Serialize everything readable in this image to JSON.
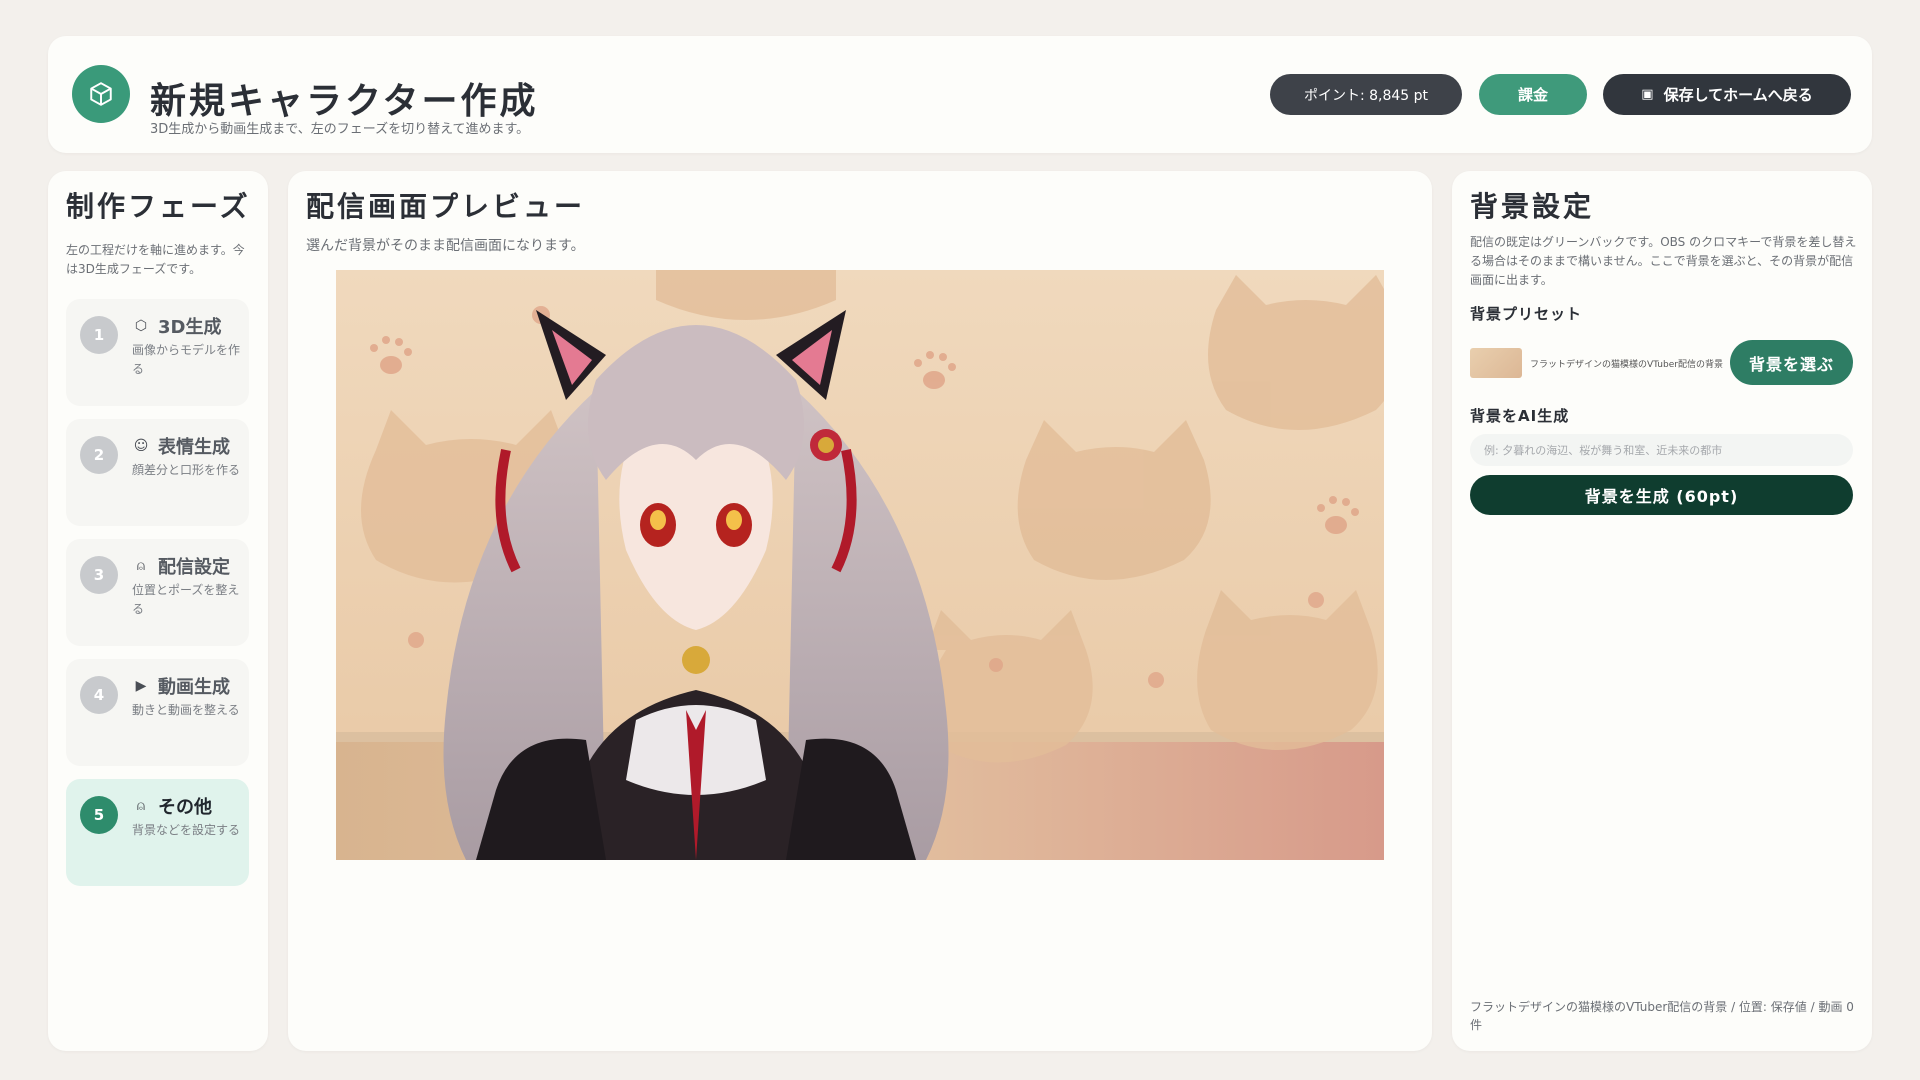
{
  "header": {
    "title": "新規キャラクター作成",
    "subtitle": "3D生成から動画生成まで、左のフェーズを切り替えて進めます。",
    "logo_icon": "cube-icon",
    "points_label": "ポイント: 8,845 pt",
    "charge_label": "課金",
    "save_home_label": "保存してホームへ戻る",
    "save_icon": "save-icon"
  },
  "phases": {
    "title": "制作フェーズ",
    "description": "左の工程だけを軸に進めます。今は3D生成フェーズです。",
    "items": [
      {
        "num": "1",
        "icon": "cube-icon",
        "glyph": "⬡",
        "title": "3D生成",
        "desc": "画像からモデルを作る",
        "active": false
      },
      {
        "num": "2",
        "icon": "smile-icon",
        "glyph": "☺",
        "title": "表情生成",
        "desc": "顔差分と口形を作る",
        "active": false
      },
      {
        "num": "3",
        "icon": "user-icon",
        "glyph": "⍝",
        "title": "配信設定",
        "desc": "位置とポーズを整える",
        "active": false
      },
      {
        "num": "4",
        "icon": "play-icon",
        "glyph": "▶",
        "title": "動画生成",
        "desc": "動きと動画を整える",
        "active": false
      },
      {
        "num": "5",
        "icon": "user-icon",
        "glyph": "⍝",
        "title": "その他",
        "desc": "背景などを設定する",
        "active": true
      }
    ]
  },
  "preview": {
    "title": "配信画面プレビュー",
    "description": "選んだ背景がそのまま配信画面になります。"
  },
  "background": {
    "title": "背景設定",
    "description": "配信の既定はグリーンバックです。OBS のクロマキーで背景を差し替える場合はそのままで構いません。ここで背景を選ぶと、その背景が配信画面に出ます。",
    "preset_label": "背景プリセット",
    "preset_name": "フラットデザインの猫模様のVTuber配信の背景",
    "choose_label": "背景を選ぶ",
    "ai_label": "背景をAI生成",
    "ai_placeholder": "例: 夕暮れの海辺、桜が舞う和室、近未来の都市",
    "generate_label": "背景を生成 (60pt)",
    "status": "フラットデザインの猫模様のVTuber配信の背景 / 位置: 保存値 / 動画 0 件"
  },
  "colors": {
    "accent": "#3a9a7a",
    "dark_button": "#31363d",
    "generate_button": "#0f3d2f",
    "active_phase_bg": "#e0f3ec",
    "page_bg": "#f3f0ec"
  }
}
